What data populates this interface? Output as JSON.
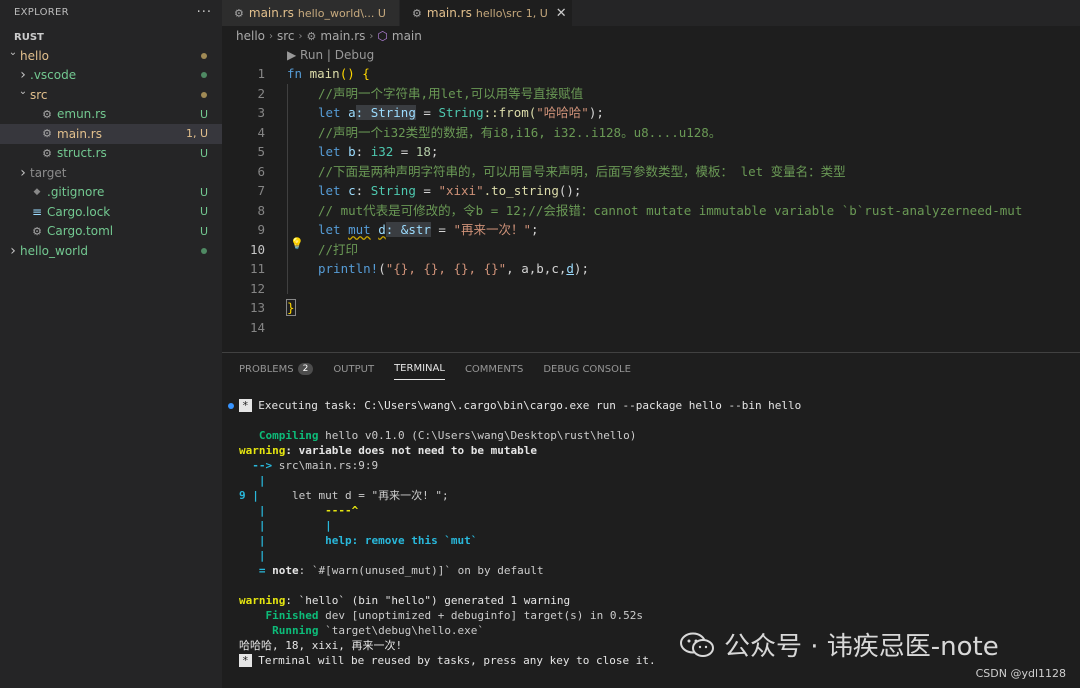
{
  "explorer": {
    "title": "EXPLORER",
    "more": "···",
    "root": "RUST"
  },
  "tree": [
    {
      "name": "hello",
      "indent": 0,
      "chev": "v",
      "kind": "folder",
      "color": "mod",
      "status": "dot-mod"
    },
    {
      "name": ".vscode",
      "indent": 1,
      "chev": ">",
      "kind": "folder",
      "color": "new",
      "status": "dot-new"
    },
    {
      "name": "src",
      "indent": 1,
      "chev": "v",
      "kind": "folder",
      "color": "mod",
      "status": "dot-mod"
    },
    {
      "name": "emun.rs",
      "indent": 2,
      "chev": "",
      "kind": "rust",
      "color": "new",
      "status": "U"
    },
    {
      "name": "main.rs",
      "indent": 2,
      "chev": "",
      "kind": "rust",
      "color": "mod",
      "status": "1, U",
      "selected": true
    },
    {
      "name": "struct.rs",
      "indent": 2,
      "chev": "",
      "kind": "rust",
      "color": "new",
      "status": "U"
    },
    {
      "name": "target",
      "indent": 1,
      "chev": ">",
      "kind": "folder",
      "color": "grey",
      "status": ""
    },
    {
      "name": ".gitignore",
      "indent": 1,
      "chev": "",
      "kind": "git",
      "color": "new",
      "status": "U"
    },
    {
      "name": "Cargo.lock",
      "indent": 1,
      "chev": "",
      "kind": "lock",
      "color": "new",
      "status": "U"
    },
    {
      "name": "Cargo.toml",
      "indent": 1,
      "chev": "",
      "kind": "gear",
      "color": "new",
      "status": "U"
    },
    {
      "name": "hello_world",
      "indent": 0,
      "chev": ">",
      "kind": "folder",
      "color": "new",
      "status": "dot-new"
    }
  ],
  "tabs": [
    {
      "name": "main.rs",
      "desc": "hello_world\\... U",
      "active": false
    },
    {
      "name": "main.rs",
      "desc": "hello\\src 1, U",
      "active": true,
      "close": "✕"
    }
  ],
  "breadcrumb": [
    "hello",
    "src",
    "main.rs",
    "main"
  ],
  "codelens": "▶ Run | Debug",
  "editor_lines": [
    "1",
    "2",
    "3",
    "4",
    "5",
    "6",
    "7",
    "8",
    "9",
    "10",
    "11",
    "12",
    "13",
    "14"
  ],
  "code": {
    "l1": {
      "kw": "fn",
      "fn": "main",
      "rest": "() {"
    },
    "l2": "//声明一个字符串,用let,可以用等号直接赋值",
    "l3": {
      "kw": "let",
      "var": "a",
      "hint": ": String",
      "eq": " = ",
      "ty": "String",
      "call": "::from(",
      "str": "\"哈哈哈\"",
      "end": ");"
    },
    "l4": "//声明一个i32类型的数据，有i8,i16, i32..i128。u8....u128。",
    "l5": {
      "kw": "let",
      "var": "b",
      "sep": ": ",
      "ty": "i32",
      "eq": " = ",
      "num": "18",
      "end": ";"
    },
    "l6": "//下面是两种声明字符串的，可以用冒号来声明，后面写参数类型，模板： let 变量名：类型",
    "l7": {
      "kw": "let",
      "var": "c",
      "sep": ": ",
      "ty": "String",
      "eq": " = ",
      "str": "\"xixi\"",
      "call": ".to_string",
      "end": "();"
    },
    "l8": "// mut代表是可修改的，令b = 12;//会报错：cannot mutate immutable variable `b`rust-analyzerneed-mut",
    "l9": {
      "kw": "let",
      "mut": "mut",
      "var": "d",
      "hint": ": &str",
      "eq": " = ",
      "str": "\"再来一次！\"",
      "end": ";"
    },
    "l10": "//打印",
    "l11": {
      "mac": "println!",
      "open": "(",
      "fmt": "\"{}, {}, {}, {}\"",
      "args": ", a,b,c,",
      "d": "d",
      "end": ");"
    },
    "l13": "}"
  },
  "panel_tabs": [
    {
      "label": "PROBLEMS",
      "badge": "2"
    },
    {
      "label": "OUTPUT"
    },
    {
      "label": "TERMINAL",
      "active": true
    },
    {
      "label": "COMMENTS"
    },
    {
      "label": "DEBUG CONSOLE"
    }
  ],
  "terminal": {
    "task_star": "*",
    "task": " Executing task: C:\\Users\\wang\\.cargo\\bin\\cargo.exe run --package hello --bin hello",
    "compiling_kw": "   Compiling",
    "compiling": " hello v0.1.0 (C:\\Users\\wang\\Desktop\\rust\\hello)",
    "warning_kw": "warning",
    "warning1": ": variable does not need to be mutable",
    "arrow": "  -->",
    "loc": " src\\main.rs:9:9",
    "pipe": "   |",
    "line9_num": "9",
    "line9_pipe": " |",
    "line9_code": "     let mut d = \"再来一次! \";",
    "caret": "         ----^",
    "pipe2": "         |",
    "help": "         help: remove this `mut`",
    "note_eq": "   =",
    "note_kw": " note",
    "note": ": `#[warn(unused_mut)]` on by default",
    "warning2": ": `hello` (bin \"hello\") generated 1 warning",
    "finished_kw": "    Finished",
    "finished": " dev [unoptimized + debuginfo] target(s) in 0.52s",
    "running_kw": "     Running",
    "running": " `target\\debug\\hello.exe`",
    "output": "哈哈哈, 18, xixi, 再来一次!",
    "reuse": " Terminal will be reused by tasks, press any key to close it."
  },
  "watermark": {
    "text": "公众号 · 讳疾忌医-note",
    "csdn": "CSDN @ydl1128"
  }
}
